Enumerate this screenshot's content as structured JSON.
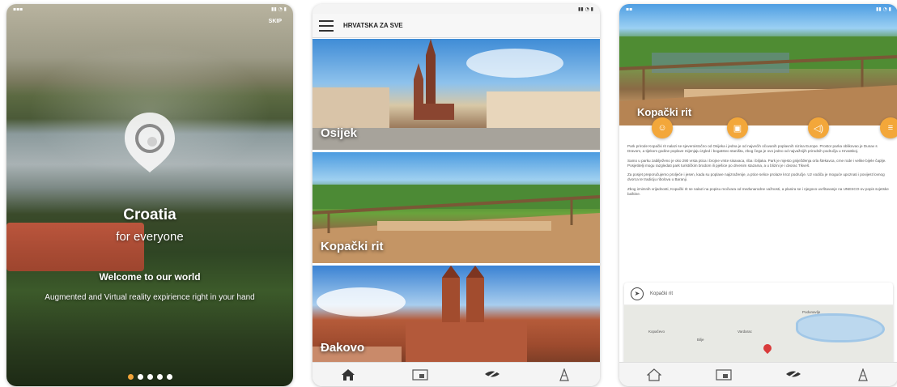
{
  "splash": {
    "skip_label": "SKIP",
    "title": "Croatia",
    "subtitle": "for everyone",
    "welcome": "Welcome to our world",
    "tagline": "Augmented and Virtual reality expirience right in your hand",
    "page_dots": 5,
    "active_dot": 1,
    "accent_color": "#f2a43a"
  },
  "list_screen": {
    "title": "HRVATSKA ZA SVE",
    "cards": [
      {
        "label": "Osijek"
      },
      {
        "label": "Kopački rit"
      },
      {
        "label": "Đakovo"
      }
    ],
    "nav_icons": [
      "home-icon",
      "ar-card-icon",
      "vr-glasses-icon",
      "tower-icon"
    ]
  },
  "detail_screen": {
    "title": "Kopački rit",
    "action_icons": [
      "smile-icon",
      "ar-icon",
      "audio-icon",
      "menu-icon"
    ],
    "action_color": "#f3a73a",
    "paragraphs": [
      "Park prirode Kopački rit nalazi se sjeveroistočno od Osijeka i jedna je od najvećih očuvanih poplavnih nizina Europe. Prostor parka oblikovao je Dunav s Dravom, a tijekom godine poplave mijenjaju izgled i bogatstvo staništa, zbog čega je ovo jedno od najvažnijih prirodnih područja u Hrvatskoj.",
      "Samo u parku zabilježeno je oko 290 vrsta ptica i brojne vrste sisavaca, riba i biljaka. Park je mjesto gniježđenja orla štekavca, crne rode i velike bijele čaplje. Posjetitelji mogu razgledati park turističkim brodom ili pješice po drvenim stazama, a u blizini je i dvorac Tikveš.",
      "Za posjet preporučujemo proljeće i jesen, kada su poplave najizraženije, a ptice selice prolaze kroz područje. Uz vodiča je moguće upoznati i povijest lovnog dvorca te tradiciju ribolova u Baranji.",
      "Zbog iznimnih vrijednosti, Kopački rit se nalazi na popisu močvara od međunarodne važnosti, a planira se i njegovo uvrštavanje na UNESCO-ov popis svjetske baštine."
    ],
    "map_title": "Kopački rit",
    "map_labels": [
      "Kopačevo",
      "Bilje",
      "Vardarac",
      "Podunavlje"
    ]
  },
  "nav_icons_detail": [
    "home-outline-icon",
    "ar-card-icon",
    "vr-glasses-icon",
    "tower-icon"
  ]
}
